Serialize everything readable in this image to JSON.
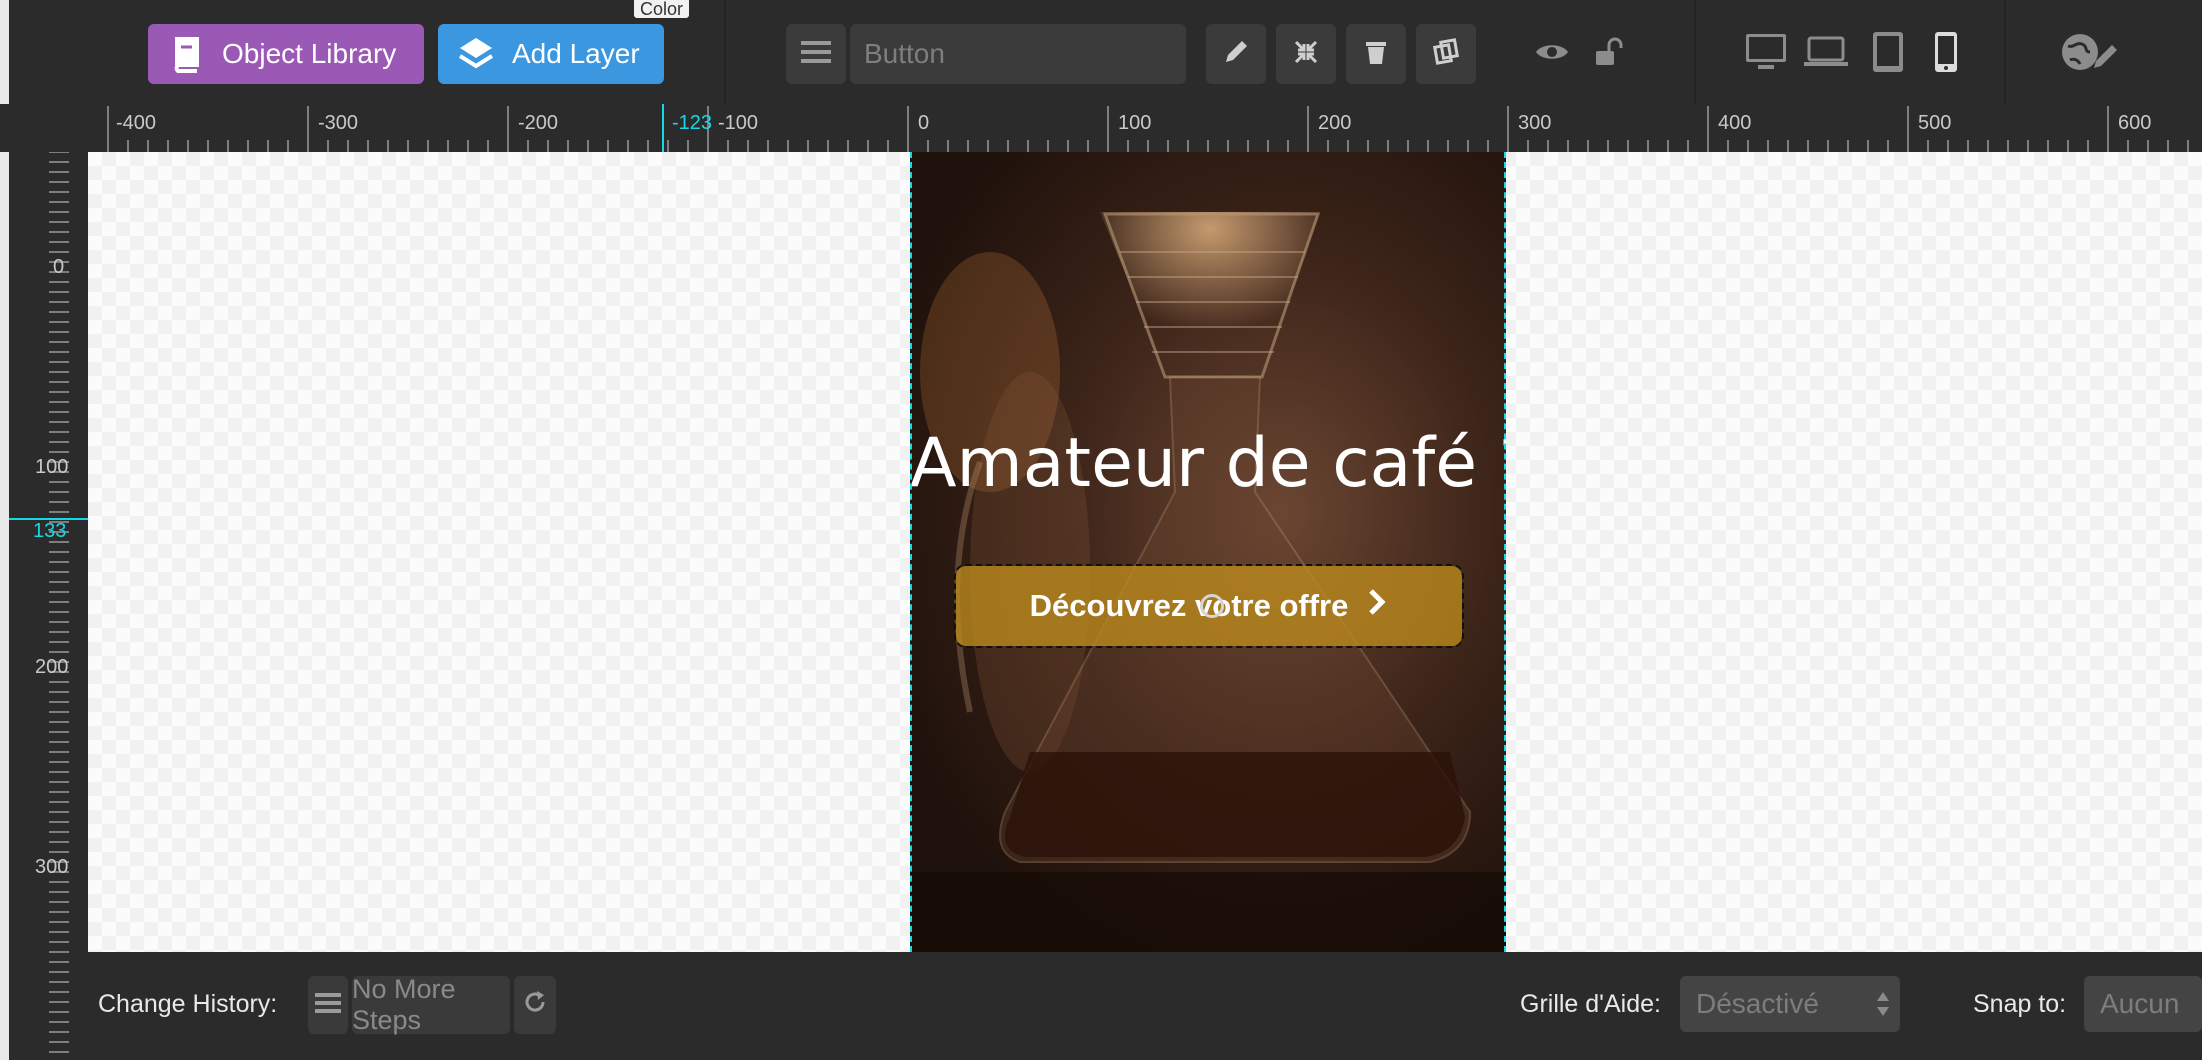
{
  "toolbar": {
    "object_library_label": "Object Library",
    "add_layer_label": "Add Layer",
    "color_tooltip": "Color",
    "layer_name_placeholder": "Button"
  },
  "rulers": {
    "horizontal_labels": [
      "-400",
      "-300",
      "-200",
      "-100",
      "0",
      "100",
      "200",
      "300",
      "400",
      "500",
      "600"
    ],
    "horizontal_cursor": "-123",
    "vertical_labels": [
      "0",
      "100",
      "200",
      "300"
    ],
    "vertical_cursor": "133"
  },
  "slide": {
    "headline": "Amateur de café ?",
    "cta_label": "Découvrez votre offre",
    "cta_icon": "chevron-right-icon"
  },
  "bottom": {
    "history_label": "Change History:",
    "history_value": "No More Steps",
    "grid_label": "Grille d'Aide:",
    "grid_value": "Désactivé",
    "snap_label": "Snap to:",
    "snap_value": "Aucun"
  },
  "colors": {
    "object_library": "#9b59b6",
    "add_layer": "#3b97e0",
    "guide": "#18d7e6",
    "cta": "#be8c1e"
  }
}
